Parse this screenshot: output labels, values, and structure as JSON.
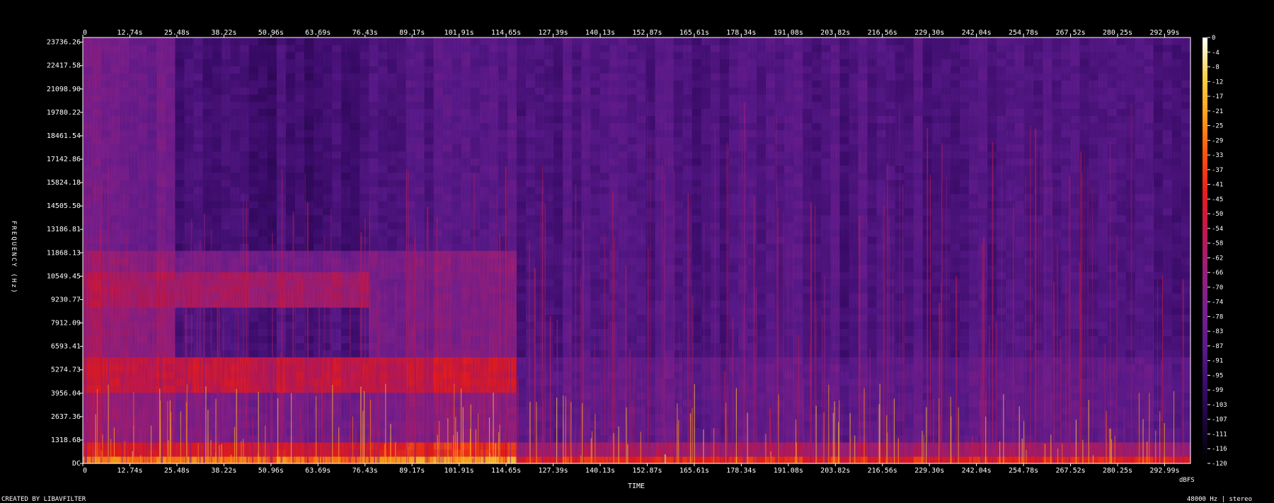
{
  "chart_data": {
    "type": "heatmap",
    "title": "",
    "xlabel": "TIME",
    "ylabel": "FREQUENCY (Hz)",
    "x_unit": "s",
    "x_ticks": [
      0,
      12.74,
      25.48,
      38.22,
      50.96,
      63.69,
      76.43,
      89.17,
      101.91,
      114.65,
      127.39,
      140.13,
      152.87,
      165.61,
      178.34,
      191.08,
      203.82,
      216.56,
      229.3,
      242.04,
      254.78,
      267.52,
      280.25,
      292.99
    ],
    "x_tick_labels": [
      "0",
      "12.74s",
      "25.48s",
      "38.22s",
      "50.96s",
      "63.69s",
      "76.43s",
      "89.17s",
      "101.91s",
      "114.65s",
      "127.39s",
      "140.13s",
      "152.87s",
      "165.61s",
      "178.34s",
      "191.08s",
      "203.82s",
      "216.56s",
      "229.30s",
      "242.04s",
      "254.78s",
      "267.52s",
      "280.25s",
      "292.99s"
    ],
    "xlim": [
      0,
      300
    ],
    "y_ticks": [
      0,
      1318.68,
      2637.36,
      3956.04,
      5274.73,
      6593.41,
      7912.09,
      9230.77,
      10549.45,
      11868.13,
      13186.81,
      14505.5,
      15824.18,
      17142.86,
      18461.54,
      19780.22,
      21098.9,
      22417.58,
      23736.26
    ],
    "y_tick_labels": [
      "DC",
      "1318.68",
      "2637.36",
      "3956.04",
      "5274.73",
      "6593.41",
      "7912.09",
      "9230.77",
      "10549.45",
      "11868.13",
      "13186.81",
      "14505.50",
      "15824.18",
      "17142.86",
      "18461.54",
      "19780.22",
      "21098.90",
      "22417.58",
      "23736.26"
    ],
    "ylim": [
      0,
      24000
    ],
    "colorbar": {
      "label": "dBFS",
      "range": [
        -120,
        0
      ],
      "tick_labels": [
        "0",
        "-4",
        "-8",
        "-12",
        "-17",
        "-21",
        "-25",
        "-29",
        "-33",
        "-37",
        "-41",
        "-45",
        "-50",
        "-54",
        "-58",
        "-62",
        "-66",
        "-70",
        "-74",
        "-78",
        "-83",
        "-87",
        "-91",
        "-95",
        "-99",
        "-103",
        "-107",
        "-111",
        "-116",
        "-120"
      ]
    },
    "segments": [
      {
        "t_start": 0,
        "t_end": 26,
        "approx_level_dbfs": {
          "0-1300Hz": -45,
          "4000-6000Hz": -50,
          "9000-11000Hz": -58,
          "above_12000Hz": -78
        }
      },
      {
        "t_start": 26,
        "t_end": 76.4,
        "approx_level_dbfs": {
          "0-1300Hz": -48,
          "4000-6000Hz": -52,
          "6000-9000Hz": -92,
          "9000-11000Hz": -62,
          "above_12000Hz": -95
        }
      },
      {
        "t_start": 76.4,
        "t_end": 117.5,
        "approx_level_dbfs": {
          "0-1300Hz": -40,
          "4000-6000Hz": -50,
          "6000-11000Hz": -74,
          "above_12000Hz": -88
        }
      },
      {
        "t_start": 117.5,
        "t_end": 300,
        "approx_level_dbfs": {
          "0-1300Hz": -62,
          "1300-6000Hz": -84,
          "above_6000Hz": -90
        }
      }
    ],
    "colormap": [
      "#000000",
      "#1a0636",
      "#3a0b6a",
      "#5a1a8c",
      "#7a1f8e",
      "#9a1f7a",
      "#c0184f",
      "#e81d1d",
      "#ff5210",
      "#ff9f1a",
      "#ffd24a",
      "#ffffff"
    ],
    "footer_left": "CREATED BY LIBAVFILTER",
    "footer_right": "48000 Hz | stereo"
  }
}
